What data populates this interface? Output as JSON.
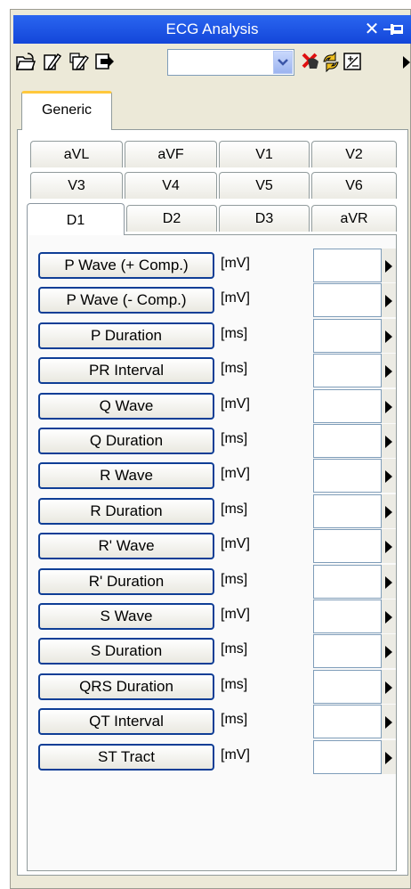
{
  "window": {
    "title": "ECG Analysis"
  },
  "toolbar": {
    "icons": [
      "open-folder-icon",
      "edit-icon",
      "multi-edit-icon",
      "export-icon",
      "delete-icon",
      "refresh-icon",
      "calculate-icon",
      "more-icon"
    ],
    "combo_value": ""
  },
  "tabs": {
    "generic_label": "Generic"
  },
  "leads": {
    "row1": [
      "aVL",
      "aVF",
      "V1",
      "V2"
    ],
    "row2": [
      "V3",
      "V4",
      "V5",
      "V6"
    ],
    "row3": [
      "D1",
      "D2",
      "D3",
      "aVR"
    ],
    "active": "D1"
  },
  "parameters": [
    {
      "label": "P Wave (+ Comp.)",
      "unit": "[mV]",
      "value": ""
    },
    {
      "label": "P Wave (- Comp.)",
      "unit": "[mV]",
      "value": ""
    },
    {
      "label": "P Duration",
      "unit": "[ms]",
      "value": ""
    },
    {
      "label": "PR Interval",
      "unit": "[ms]",
      "value": ""
    },
    {
      "label": "Q Wave",
      "unit": "[mV]",
      "value": ""
    },
    {
      "label": "Q Duration",
      "unit": "[ms]",
      "value": ""
    },
    {
      "label": "R Wave",
      "unit": "[mV]",
      "value": ""
    },
    {
      "label": "R Duration",
      "unit": "[ms]",
      "value": ""
    },
    {
      "label": "R' Wave",
      "unit": "[mV]",
      "value": ""
    },
    {
      "label": "R' Duration",
      "unit": "[ms]",
      "value": ""
    },
    {
      "label": "S Wave",
      "unit": "[mV]",
      "value": ""
    },
    {
      "label": "S Duration",
      "unit": "[ms]",
      "value": ""
    },
    {
      "label": "QRS Duration",
      "unit": "[ms]",
      "value": ""
    },
    {
      "label": "QT Interval",
      "unit": "[ms]",
      "value": ""
    },
    {
      "label": "ST Tract",
      "unit": "[mV]",
      "value": ""
    }
  ],
  "colors": {
    "title_bar": "#2a65f0",
    "button_border": "#0f3e96",
    "tab_highlight": "#ffc83c"
  }
}
